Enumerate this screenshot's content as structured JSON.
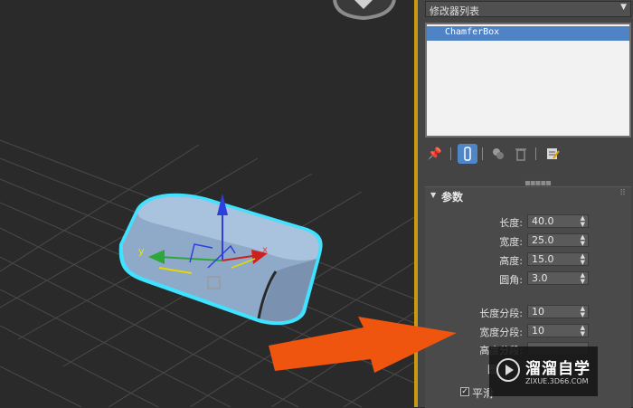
{
  "modifier_list": {
    "label": "修改器列表",
    "arrow_icon": "dropdown-arrow-icon"
  },
  "stack": {
    "items": [
      {
        "label": "ChamferBox",
        "selected": true
      }
    ]
  },
  "toolbar": {
    "buttons": [
      {
        "icon": "pin-icon"
      },
      {
        "icon": "show-end-result-icon",
        "active": true
      },
      {
        "icon": "make-unique-icon"
      },
      {
        "icon": "remove-modifier-icon"
      },
      {
        "icon": "configure-sets-icon"
      }
    ]
  },
  "params": {
    "title": "参数",
    "length": {
      "label": "长度:",
      "value": "40.0"
    },
    "width": {
      "label": "宽度:",
      "value": "25.0"
    },
    "height": {
      "label": "高度:",
      "value": "15.0"
    },
    "fillet": {
      "label": "圆角:",
      "value": "3.0"
    },
    "length_segs": {
      "label": "长度分段:",
      "value": "10"
    },
    "width_segs": {
      "label": "宽度分段:",
      "value": "10"
    },
    "height_segs": {
      "label": "高度分段:"
    },
    "fillet_segs": {
      "label": "圆"
    },
    "smooth": {
      "label": "平滑",
      "checked": true
    }
  },
  "viewport": {
    "axis_y": "y",
    "axis_x": "x"
  },
  "watermark": {
    "name": "溜溜自学",
    "url": "ZIXUE.3D66.COM"
  },
  "colors": {
    "selection": "#4f83c6",
    "highlight_outline": "#3fe3ff",
    "arrow": "#f0550f",
    "divider": "#c79a12"
  }
}
